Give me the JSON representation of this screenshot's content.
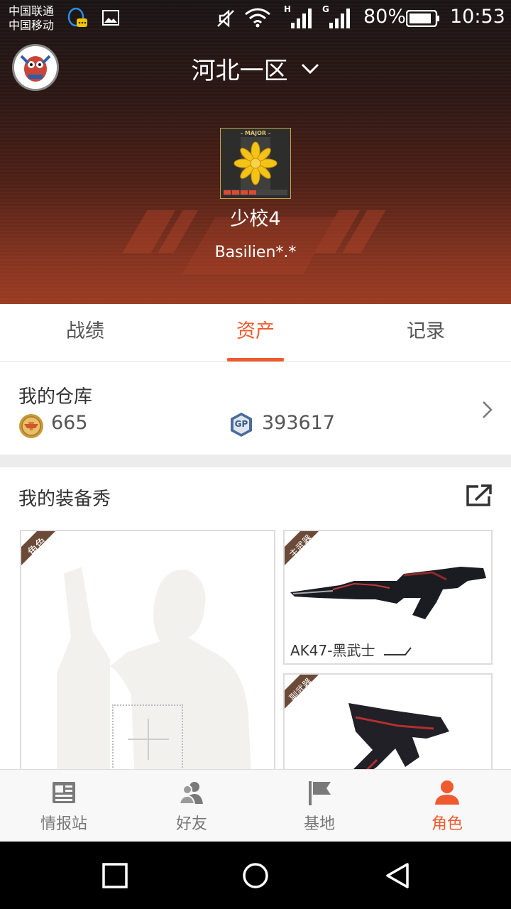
{
  "status_bar": {
    "carrier_1": "中国联通",
    "carrier_2": "中国移动",
    "network_1": "H",
    "network_2": "G",
    "battery": "80%",
    "time": "10:53"
  },
  "header": {
    "server": "河北一区",
    "rank_badge_text": "- MAJOR -",
    "rank": "少校4",
    "player": "Basilien*.*"
  },
  "tabs": [
    {
      "label": "战绩",
      "active": false
    },
    {
      "label": "资产",
      "active": true
    },
    {
      "label": "记录",
      "active": false
    }
  ],
  "warehouse": {
    "title": "我的仓库",
    "coin_value": "665",
    "gp_label": "GP",
    "gp_value": "393617"
  },
  "equipment": {
    "title": "我的装备秀",
    "role_tag": "角色",
    "primary_tag": "主武器",
    "primary_name": "AK47-黑武士",
    "secondary_tag": "副武器"
  },
  "bottom_nav": [
    {
      "label": "情报站",
      "icon": "news-icon",
      "active": false
    },
    {
      "label": "好友",
      "icon": "friends-icon",
      "active": false
    },
    {
      "label": "基地",
      "icon": "flag-icon",
      "active": false
    },
    {
      "label": "角色",
      "icon": "person-icon",
      "active": true
    }
  ],
  "colors": {
    "accent": "#ef5a2e",
    "header_dark": "#1a1514",
    "header_red": "#9a3b22"
  }
}
